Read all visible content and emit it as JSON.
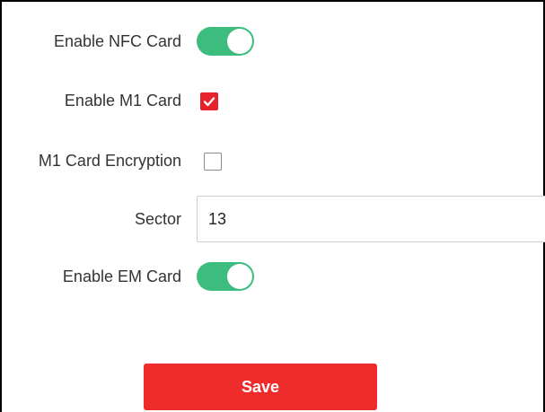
{
  "form": {
    "nfc": {
      "label": "Enable NFC Card",
      "enabled": true
    },
    "m1": {
      "label": "Enable M1 Card",
      "checked": true
    },
    "m1_encryption": {
      "label": "M1 Card Encryption",
      "checked": false
    },
    "sector": {
      "label": "Sector",
      "value": "13"
    },
    "em": {
      "label": "Enable EM Card",
      "enabled": true
    },
    "save_label": "Save"
  },
  "colors": {
    "toggle_on": "#3dbd7d",
    "checkbox_checked": "#e8222c",
    "save_button": "#ee2c2c"
  }
}
